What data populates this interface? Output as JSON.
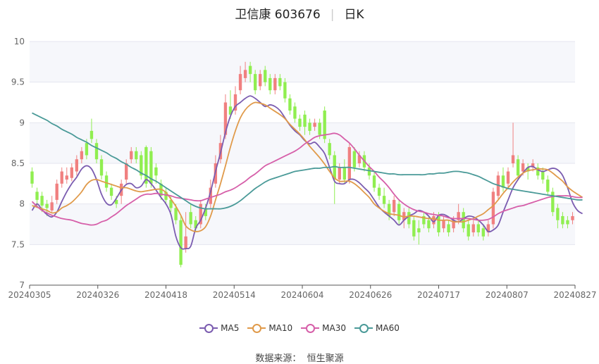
{
  "title": {
    "name": "卫信康 603676",
    "period": "日K"
  },
  "source": {
    "label": "数据来源：",
    "name": "恒生聚源"
  },
  "chart_data": {
    "type": "candlestick",
    "title": "卫信康 603676 日K",
    "ylim": [
      7,
      10
    ],
    "yticks": [
      7,
      7.5,
      8,
      8.5,
      9,
      9.5,
      10
    ],
    "ytick_labels": [
      "7",
      "7.5",
      "8",
      "8.5",
      "9",
      "9.5",
      "10"
    ],
    "xtick_labels": [
      "20240305",
      "20240326",
      "20240418",
      "20240514",
      "20240604",
      "20240626",
      "20240717",
      "20240807",
      "20240827"
    ],
    "grid": "horizontal",
    "legend_position": "bottom",
    "up_color": "#f08080",
    "down_color": "#90ee50",
    "series_colors": {
      "MA5": "#7b5cb0",
      "MA10": "#e09a4a",
      "MA30": "#d65fa9",
      "MA60": "#4a9a98"
    },
    "candles": [
      [
        8.4,
        8.25,
        8.45,
        8.2
      ],
      [
        8.15,
        8.05,
        8.2,
        7.95
      ],
      [
        8.1,
        7.98,
        8.15,
        7.9
      ],
      [
        8.0,
        7.95,
        8.05,
        7.85
      ],
      [
        7.92,
        8.02,
        8.1,
        7.9
      ],
      [
        8.05,
        8.25,
        8.3,
        8.0
      ],
      [
        8.25,
        8.4,
        8.45,
        8.2
      ],
      [
        8.3,
        8.35,
        8.45,
        8.25
      ],
      [
        8.32,
        8.45,
        8.5,
        8.28
      ],
      [
        8.4,
        8.55,
        8.6,
        8.35
      ],
      [
        8.55,
        8.65,
        8.7,
        8.5
      ],
      [
        8.75,
        8.6,
        8.8,
        8.55
      ],
      [
        8.9,
        8.8,
        9.05,
        8.75
      ],
      [
        8.75,
        8.55,
        8.8,
        8.5
      ],
      [
        8.55,
        8.35,
        8.6,
        8.3
      ],
      [
        8.35,
        8.2,
        8.4,
        8.15
      ],
      [
        8.2,
        8.1,
        8.25,
        8.05
      ],
      [
        8.05,
        8.0,
        8.1,
        7.95
      ],
      [
        8.1,
        8.25,
        8.3,
        8.0
      ],
      [
        8.3,
        8.5,
        8.55,
        8.25
      ],
      [
        8.55,
        8.65,
        8.7,
        8.5
      ],
      [
        8.65,
        8.55,
        8.7,
        8.5
      ],
      [
        8.6,
        8.35,
        8.65,
        8.3
      ],
      [
        8.7,
        8.25,
        8.72,
        8.2
      ],
      [
        8.65,
        8.25,
        8.7,
        8.2
      ],
      [
        8.45,
        8.35,
        8.5,
        8.25
      ],
      [
        8.25,
        8.1,
        8.3,
        8.05
      ],
      [
        8.15,
        8.05,
        8.2,
        8.0
      ],
      [
        8.05,
        7.95,
        8.1,
        7.9
      ],
      [
        7.95,
        7.8,
        8.0,
        7.75
      ],
      [
        7.8,
        7.25,
        7.85,
        7.22
      ],
      [
        7.45,
        7.6,
        7.9,
        7.4
      ],
      [
        7.9,
        7.75,
        8.0,
        7.7
      ],
      [
        7.8,
        7.7,
        7.85,
        7.65
      ],
      [
        7.75,
        8.0,
        8.05,
        7.7
      ],
      [
        7.95,
        7.85,
        8.0,
        7.8
      ],
      [
        8.0,
        8.2,
        8.3,
        7.95
      ],
      [
        8.25,
        8.5,
        8.6,
        8.2
      ],
      [
        8.55,
        8.75,
        8.85,
        8.5
      ],
      [
        8.85,
        9.25,
        9.35,
        8.8
      ],
      [
        9.2,
        9.1,
        9.4,
        9.05
      ],
      [
        9.15,
        9.35,
        9.45,
        9.1
      ],
      [
        9.4,
        9.6,
        9.7,
        9.35
      ],
      [
        9.55,
        9.65,
        9.75,
        9.5
      ],
      [
        9.7,
        9.6,
        9.75,
        9.5
      ],
      [
        9.6,
        9.4,
        9.65,
        9.35
      ],
      [
        9.45,
        9.6,
        9.65,
        9.4
      ],
      [
        9.65,
        9.5,
        9.7,
        9.45
      ],
      [
        9.55,
        9.4,
        9.6,
        9.35
      ],
      [
        9.4,
        9.55,
        9.6,
        9.35
      ],
      [
        9.55,
        9.45,
        9.6,
        9.4
      ],
      [
        9.5,
        9.3,
        9.55,
        9.25
      ],
      [
        9.3,
        9.15,
        9.35,
        9.1
      ],
      [
        9.2,
        9.05,
        9.25,
        9.0
      ],
      [
        9.05,
        8.95,
        9.1,
        8.9
      ],
      [
        9.1,
        8.95,
        9.15,
        8.85
      ],
      [
        9.0,
        8.9,
        9.05,
        8.85
      ],
      [
        8.95,
        9.0,
        9.05,
        8.9
      ],
      [
        9.0,
        8.85,
        9.05,
        8.8
      ],
      [
        9.15,
        8.8,
        9.2,
        8.75
      ],
      [
        8.75,
        8.6,
        8.8,
        8.55
      ],
      [
        8.6,
        8.3,
        8.65,
        8.0
      ],
      [
        8.3,
        8.45,
        8.5,
        8.25
      ],
      [
        8.45,
        8.3,
        8.55,
        8.25
      ],
      [
        8.3,
        8.7,
        8.75,
        8.25
      ],
      [
        8.65,
        8.45,
        8.7,
        8.4
      ],
      [
        8.5,
        8.6,
        8.65,
        8.45
      ],
      [
        8.6,
        8.45,
        8.65,
        8.4
      ],
      [
        8.45,
        8.35,
        8.5,
        8.3
      ],
      [
        8.35,
        8.2,
        8.4,
        8.15
      ],
      [
        8.2,
        8.1,
        8.25,
        8.05
      ],
      [
        8.1,
        8.0,
        8.2,
        7.95
      ],
      [
        8.0,
        7.85,
        8.05,
        7.8
      ],
      [
        7.9,
        8.05,
        8.1,
        7.85
      ],
      [
        8.0,
        7.8,
        8.05,
        7.75
      ],
      [
        7.8,
        7.9,
        7.95,
        7.7
      ],
      [
        7.9,
        7.75,
        7.95,
        7.7
      ],
      [
        7.8,
        7.6,
        7.85,
        7.55
      ],
      [
        7.7,
        7.65,
        7.8,
        7.5
      ],
      [
        7.85,
        7.75,
        7.9,
        7.7
      ],
      [
        7.8,
        7.7,
        7.85,
        7.65
      ],
      [
        7.75,
        7.85,
        7.9,
        7.7
      ],
      [
        7.85,
        7.65,
        7.9,
        7.6
      ],
      [
        7.7,
        7.8,
        7.85,
        7.65
      ],
      [
        7.75,
        7.65,
        7.8,
        7.6
      ],
      [
        7.7,
        7.8,
        7.85,
        7.65
      ],
      [
        7.8,
        7.9,
        8.0,
        7.75
      ],
      [
        7.9,
        7.7,
        7.95,
        7.65
      ],
      [
        7.75,
        7.6,
        7.8,
        7.55
      ],
      [
        7.65,
        7.75,
        7.8,
        7.6
      ],
      [
        7.75,
        7.65,
        7.8,
        7.6
      ],
      [
        7.7,
        7.6,
        7.75,
        7.55
      ],
      [
        7.65,
        7.75,
        7.8,
        7.6
      ],
      [
        7.75,
        8.15,
        8.2,
        7.7
      ],
      [
        8.1,
        8.35,
        8.4,
        8.05
      ],
      [
        8.35,
        8.2,
        8.45,
        8.15
      ],
      [
        8.25,
        8.4,
        8.45,
        8.2
      ],
      [
        8.5,
        8.6,
        9.0,
        8.45
      ],
      [
        8.55,
        8.35,
        8.6,
        8.3
      ],
      [
        8.4,
        8.5,
        8.55,
        8.35
      ],
      [
        8.45,
        8.4,
        8.5,
        8.3
      ],
      [
        8.45,
        8.5,
        8.55,
        8.4
      ],
      [
        8.45,
        8.35,
        8.5,
        8.3
      ],
      [
        8.4,
        8.3,
        8.45,
        8.25
      ],
      [
        8.3,
        8.15,
        8.35,
        8.1
      ],
      [
        8.15,
        7.9,
        8.2,
        7.85
      ],
      [
        7.95,
        7.8,
        8.0,
        7.7
      ],
      [
        7.85,
        7.75,
        7.9,
        7.7
      ],
      [
        7.8,
        7.75,
        7.85,
        7.7
      ],
      [
        7.8,
        7.85,
        7.9,
        7.75
      ]
    ],
    "series": [
      {
        "name": "MA5",
        "values": [
          7.92,
          8.0,
          7.93,
          7.87,
          7.84,
          7.9,
          8.03,
          8.15,
          8.25,
          8.33,
          8.43,
          8.47,
          8.43,
          8.3,
          8.12,
          8.01,
          7.99,
          8.07,
          8.17,
          8.24,
          8.25,
          8.2,
          8.22,
          8.3,
          8.25,
          8.17,
          8.08,
          8.0,
          7.87,
          7.6,
          7.46,
          7.45,
          7.48,
          7.7,
          7.8,
          7.95,
          8.15,
          8.4,
          8.63,
          8.88,
          9.08,
          9.2,
          9.25,
          9.3,
          9.33,
          9.3,
          9.25,
          9.2,
          9.22,
          9.2,
          9.15,
          9.06,
          8.97,
          8.9,
          8.85,
          8.78,
          8.74,
          8.76,
          8.7,
          8.62,
          8.45,
          8.28,
          8.25,
          8.25,
          8.3,
          8.3,
          8.26,
          8.2,
          8.14,
          8.05,
          7.96,
          7.9,
          7.85,
          7.8,
          7.74,
          7.8,
          7.85,
          7.88,
          7.92,
          7.9,
          7.85,
          7.78,
          7.86,
          7.87,
          7.84,
          7.8,
          7.78,
          7.82,
          7.85,
          7.84,
          7.8,
          7.74,
          7.66,
          7.68,
          7.74,
          7.9,
          8.05,
          8.2,
          8.3,
          8.38,
          8.45,
          8.46,
          8.42,
          8.4,
          8.42,
          8.44,
          8.42,
          8.35,
          8.2,
          8.02,
          7.92,
          7.88
        ]
      },
      {
        "name": "MA10",
        "values": [
          7.98,
          7.96,
          7.94,
          7.92,
          7.89,
          7.9,
          7.95,
          7.98,
          8.02,
          8.08,
          8.15,
          8.24,
          8.29,
          8.3,
          8.28,
          8.26,
          8.24,
          8.22,
          8.2,
          8.2,
          8.18,
          8.16,
          8.15,
          8.16,
          8.17,
          8.18,
          8.18,
          8.14,
          8.06,
          7.97,
          7.86,
          7.73,
          7.68,
          7.66,
          7.67,
          7.72,
          7.85,
          8.05,
          8.25,
          8.47,
          8.7,
          8.9,
          9.06,
          9.16,
          9.22,
          9.25,
          9.24,
          9.22,
          9.18,
          9.14,
          9.1,
          9.05,
          8.98,
          8.92,
          8.86,
          8.79,
          8.71,
          8.64,
          8.57,
          8.49,
          8.4,
          8.32,
          8.28,
          8.28,
          8.28,
          8.25,
          8.2,
          8.14,
          8.08,
          8.0,
          7.95,
          7.91,
          7.88,
          7.87,
          7.86,
          7.84,
          7.85,
          7.85,
          7.84,
          7.83,
          7.82,
          7.82,
          7.8,
          7.8,
          7.8,
          7.78,
          7.78,
          7.78,
          7.8,
          7.82,
          7.85,
          7.88,
          7.93,
          7.98,
          8.05,
          8.13,
          8.2,
          8.27,
          8.33,
          8.38,
          8.41,
          8.42,
          8.43,
          8.43,
          8.42,
          8.38,
          8.33,
          8.28,
          8.21,
          8.16,
          8.12,
          8.08
        ]
      },
      {
        "name": "MA30",
        "values": [
          8.03,
          7.97,
          7.92,
          7.89,
          7.86,
          7.84,
          7.82,
          7.81,
          7.8,
          7.78,
          7.76,
          7.75,
          7.74,
          7.75,
          7.78,
          7.8,
          7.84,
          7.88,
          7.93,
          7.98,
          8.02,
          8.06,
          8.1,
          8.12,
          8.12,
          8.13,
          8.12,
          8.11,
          8.1,
          8.08,
          8.07,
          8.06,
          8.05,
          8.04,
          8.04,
          8.06,
          8.08,
          8.1,
          8.12,
          8.15,
          8.17,
          8.2,
          8.24,
          8.28,
          8.33,
          8.37,
          8.42,
          8.47,
          8.5,
          8.53,
          8.56,
          8.59,
          8.62,
          8.65,
          8.69,
          8.74,
          8.78,
          8.82,
          8.84,
          8.85,
          8.86,
          8.87,
          8.85,
          8.8,
          8.75,
          8.68,
          8.6,
          8.53,
          8.46,
          8.4,
          8.33,
          8.27,
          8.2,
          8.12,
          8.05,
          8.0,
          7.96,
          7.93,
          7.91,
          7.9,
          7.88,
          7.87,
          7.86,
          7.85,
          7.83,
          7.82,
          7.82,
          7.82,
          7.82,
          7.81,
          7.8,
          7.8,
          7.81,
          7.84,
          7.88,
          7.91,
          7.93,
          7.95,
          7.97,
          7.98,
          8.0,
          8.02,
          8.04,
          8.06,
          8.08,
          8.09,
          8.1,
          8.1,
          8.1,
          8.09,
          8.08,
          8.08
        ]
      },
      {
        "name": "MA60",
        "values": [
          9.12,
          9.09,
          9.06,
          9.03,
          8.99,
          8.96,
          8.92,
          8.89,
          8.86,
          8.82,
          8.79,
          8.76,
          8.72,
          8.69,
          8.66,
          8.63,
          8.59,
          8.56,
          8.52,
          8.49,
          8.45,
          8.42,
          8.38,
          8.35,
          8.31,
          8.28,
          8.24,
          8.2,
          8.16,
          8.12,
          8.08,
          8.04,
          8.0,
          7.97,
          7.95,
          7.94,
          7.94,
          7.94,
          7.94,
          7.95,
          7.97,
          8.0,
          8.04,
          8.09,
          8.14,
          8.19,
          8.23,
          8.27,
          8.3,
          8.32,
          8.34,
          8.36,
          8.38,
          8.4,
          8.41,
          8.42,
          8.43,
          8.44,
          8.44,
          8.45,
          8.45,
          8.46,
          8.45,
          8.45,
          8.45,
          8.44,
          8.43,
          8.42,
          8.41,
          8.4,
          8.39,
          8.38,
          8.37,
          8.37,
          8.36,
          8.36,
          8.36,
          8.36,
          8.36,
          8.36,
          8.37,
          8.37,
          8.38,
          8.38,
          8.39,
          8.4,
          8.4,
          8.39,
          8.38,
          8.36,
          8.34,
          8.31,
          8.28,
          8.25,
          8.23,
          8.21,
          8.19,
          8.18,
          8.17,
          8.16,
          8.15,
          8.14,
          8.13,
          8.12,
          8.11,
          8.1,
          8.09,
          8.08,
          8.07,
          8.06,
          8.05,
          8.05
        ]
      }
    ]
  }
}
